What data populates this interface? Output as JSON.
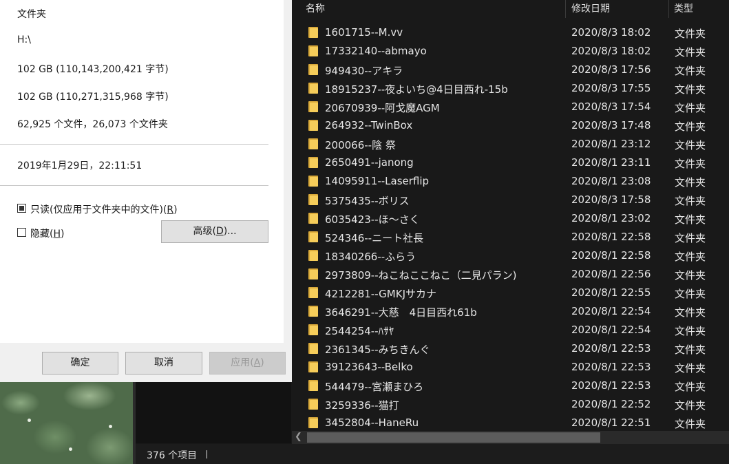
{
  "properties": {
    "type_value": "文件夹",
    "location_value": "H:\\",
    "size_value": "102 GB (110,143,200,421 字节)",
    "size_on_disk_value": "102 GB (110,271,315,968 字节)",
    "contains_value": "62,925 个文件，26,073 个文件夹",
    "created_value": "2019年1月29日，22:11:51",
    "readonly_label": "只读(仅应用于文件夹中的文件)(",
    "readonly_key": "R",
    "readonly_tail": ")",
    "hidden_label": "隐藏(",
    "hidden_key": "H",
    "hidden_tail": ")",
    "advanced_label": "高级(",
    "advanced_key": "D",
    "advanced_tail": ")...",
    "ok_label": "确定",
    "cancel_label": "取消",
    "apply_label": "应用(",
    "apply_key": "A",
    "apply_tail": ")"
  },
  "explorer": {
    "columns": {
      "name": "名称",
      "modified": "修改日期",
      "type": "类型"
    },
    "rows": [
      {
        "name": "1601715--M.vv",
        "date": "2020/8/3 18:02",
        "type": "文件夹"
      },
      {
        "name": "17332140--abmayo",
        "date": "2020/8/3 18:02",
        "type": "文件夹"
      },
      {
        "name": "949430--アキラ",
        "date": "2020/8/3 17:56",
        "type": "文件夹"
      },
      {
        "name": "18915237--夜よいち@4日目西れ-15b",
        "date": "2020/8/3 17:55",
        "type": "文件夹"
      },
      {
        "name": "20670939--阿戈魔AGM",
        "date": "2020/8/3 17:54",
        "type": "文件夹"
      },
      {
        "name": "264932--TwinBox",
        "date": "2020/8/3 17:48",
        "type": "文件夹"
      },
      {
        "name": "200066--陰 祭",
        "date": "2020/8/1 23:12",
        "type": "文件夹"
      },
      {
        "name": "2650491--janong",
        "date": "2020/8/1 23:11",
        "type": "文件夹"
      },
      {
        "name": "14095911--Laserflip",
        "date": "2020/8/1 23:08",
        "type": "文件夹"
      },
      {
        "name": "5375435--ボリス",
        "date": "2020/8/3 17:58",
        "type": "文件夹"
      },
      {
        "name": "6035423--ほ～さく",
        "date": "2020/8/1 23:02",
        "type": "文件夹"
      },
      {
        "name": "524346--ニート社長",
        "date": "2020/8/1 22:58",
        "type": "文件夹"
      },
      {
        "name": "18340266--ふらう",
        "date": "2020/8/1 22:58",
        "type": "文件夹"
      },
      {
        "name": "2973809--ねこねここねこ（二見パラン)",
        "date": "2020/8/1 22:56",
        "type": "文件夹"
      },
      {
        "name": "4212281--GMKJサカナ",
        "date": "2020/8/1 22:55",
        "type": "文件夹"
      },
      {
        "name": "3646291--大慈　4日目西れ61b",
        "date": "2020/8/1 22:54",
        "type": "文件夹"
      },
      {
        "name": "2544254--ﾊｻﾔ",
        "date": "2020/8/1 22:54",
        "type": "文件夹"
      },
      {
        "name": "2361345--みちきんぐ",
        "date": "2020/8/1 22:53",
        "type": "文件夹"
      },
      {
        "name": "39123643--Belko",
        "date": "2020/8/1 22:53",
        "type": "文件夹"
      },
      {
        "name": "544479--宮瀬まひろ",
        "date": "2020/8/1 22:53",
        "type": "文件夹"
      },
      {
        "name": "3259336--猫打",
        "date": "2020/8/1 22:52",
        "type": "文件夹"
      },
      {
        "name": "3452804--HaneRu",
        "date": "2020/8/1 22:51",
        "type": "文件夹"
      }
    ]
  },
  "status": {
    "item_count": "376 个项目"
  },
  "icons": {
    "folder": "folder-icon",
    "scroll_left": "chevron-left-icon"
  },
  "colors": {
    "folder_front": "#f6cd5a",
    "folder_back": "#d9a93a",
    "explorer_bg": "#191919",
    "dialog_bg": "#f0f0f0"
  }
}
